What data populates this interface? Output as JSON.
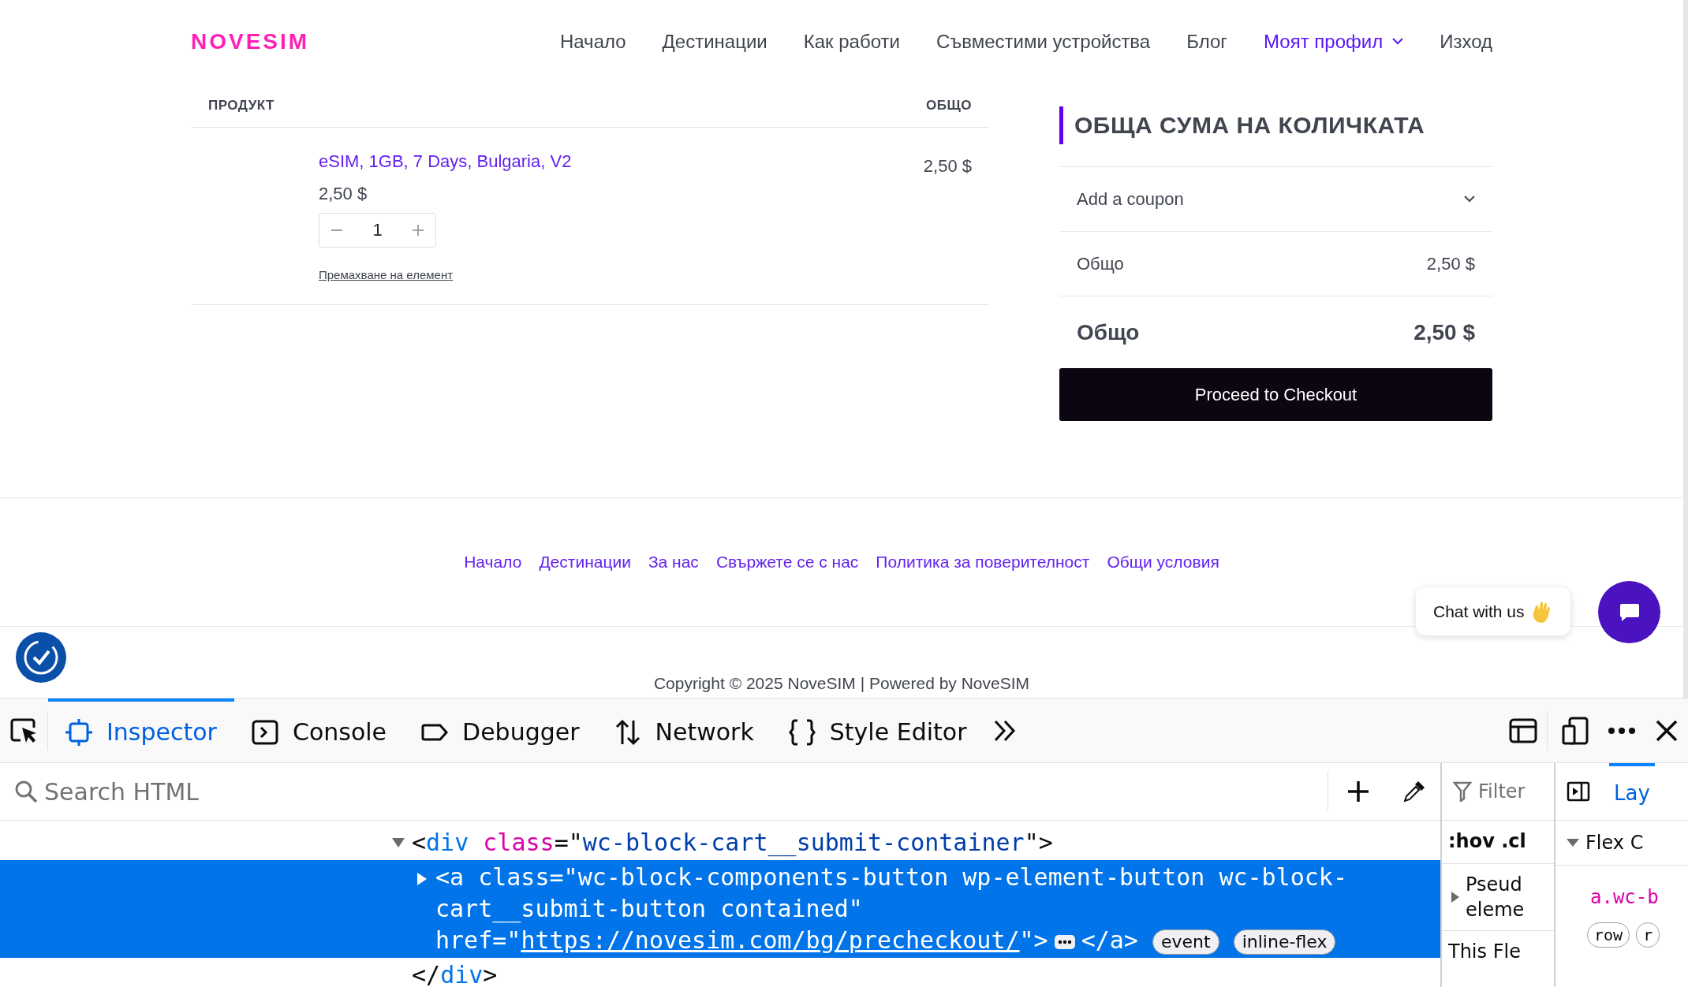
{
  "header": {
    "logo": "NOVESIM",
    "nav": [
      {
        "label": "Начало",
        "selected": false,
        "has_menu": false
      },
      {
        "label": "Дестинации",
        "selected": false,
        "has_menu": false
      },
      {
        "label": "Как работи",
        "selected": false,
        "has_menu": false
      },
      {
        "label": "Съвместими устройства",
        "selected": false,
        "has_menu": false
      },
      {
        "label": "Блог",
        "selected": false,
        "has_menu": false
      },
      {
        "label": "Моят профил",
        "selected": true,
        "has_menu": true
      },
      {
        "label": "Изход",
        "selected": false,
        "has_menu": false
      }
    ]
  },
  "cart": {
    "columns": [
      "ПРОДУКТ",
      "ОБЩО"
    ],
    "items": [
      {
        "name": "eSIM, 1GB, 7 Days, Bulgaria, V2",
        "price": "2,50 $",
        "quantity": "1",
        "remove": "Премахване на елемент",
        "total": "2,50 $"
      }
    ]
  },
  "summary": {
    "title": "ОБЩА СУМА НА КОЛИЧКАТА",
    "coupon": {
      "label": "Add a coupon",
      "expanded": false
    },
    "rows": [
      {
        "kind": "subtotal",
        "label": "Общо",
        "value": "2,50 $"
      },
      {
        "kind": "total",
        "label": "Общо",
        "value": "2,50 $"
      }
    ],
    "checkout_button": "Proceed to Checkout"
  },
  "footer": {
    "links": [
      "Начало",
      "Дестинации",
      "За нас",
      "Свържете се с нас",
      "Политика за поверителност",
      "Общи условия"
    ],
    "chat": "Chat with us",
    "copyright": "Copyright © 2025 NoveSIM | Powered by NoveSIM"
  },
  "devtools": {
    "tabs": [
      {
        "label": "Inspector",
        "selected": true
      },
      {
        "label": "Console",
        "selected": false
      },
      {
        "label": "Debugger",
        "selected": false
      },
      {
        "label": "Network",
        "selected": false
      },
      {
        "label": "Style Editor",
        "selected": false
      }
    ],
    "search": {
      "placeholder": "Search HTML"
    },
    "markup": [
      {
        "expanded": true,
        "selected": false,
        "parts": [
          {
            "kind": "punct",
            "t": "<"
          },
          {
            "kind": "tag",
            "t": "div"
          },
          {
            "kind": "attr",
            "t": "class"
          },
          {
            "kind": "punct",
            "t": "=\""
          },
          {
            "kind": "value",
            "t": "wc-block-cart__submit-container"
          },
          {
            "kind": "punct",
            "t": "\">"
          }
        ],
        "children": [
          {
            "expanded": false,
            "selected": true,
            "parts": [
              {
                "kind": "punct",
                "t": "<"
              },
              {
                "kind": "tag",
                "t": "a"
              },
              {
                "kind": "attr",
                "t": "class"
              },
              {
                "kind": "punct",
                "t": "=\""
              },
              {
                "kind": "value",
                "t": "wc-block-components-button wp-element-button wc-block-cart__submit-button contained"
              },
              {
                "kind": "punct",
                "t": "\""
              },
              {
                "kind": "attr",
                "t": "href"
              },
              {
                "kind": "punct",
                "t": "=\""
              },
              {
                "kind": "link",
                "t": "https://novesim.com/bg/precheckout/"
              },
              {
                "kind": "punct",
                "t": "\">"
              }
            ],
            "close": "</a>",
            "badges": [
              "event",
              "inline-flex"
            ]
          }
        ],
        "closing": [
          {
            "kind": "punct",
            "t": "</"
          },
          {
            "kind": "tag",
            "t": "div"
          },
          {
            "kind": "punct",
            "t": ">"
          }
        ]
      }
    ],
    "rules": {
      "filter_placeholder": "Filter",
      "pseudo_toggles": ":hov .cl",
      "sections": [
        {
          "lines": [
            "Pseud",
            "eleme"
          ],
          "expanded": false
        }
      ],
      "bottom": "This Fle"
    },
    "layout": {
      "tab": "Lay",
      "tab_selected": true,
      "section": "Flex C",
      "section_expanded": true,
      "selector_tag": "a",
      "selector_class": ".wc-b",
      "badges": [
        "row",
        "r"
      ]
    }
  }
}
